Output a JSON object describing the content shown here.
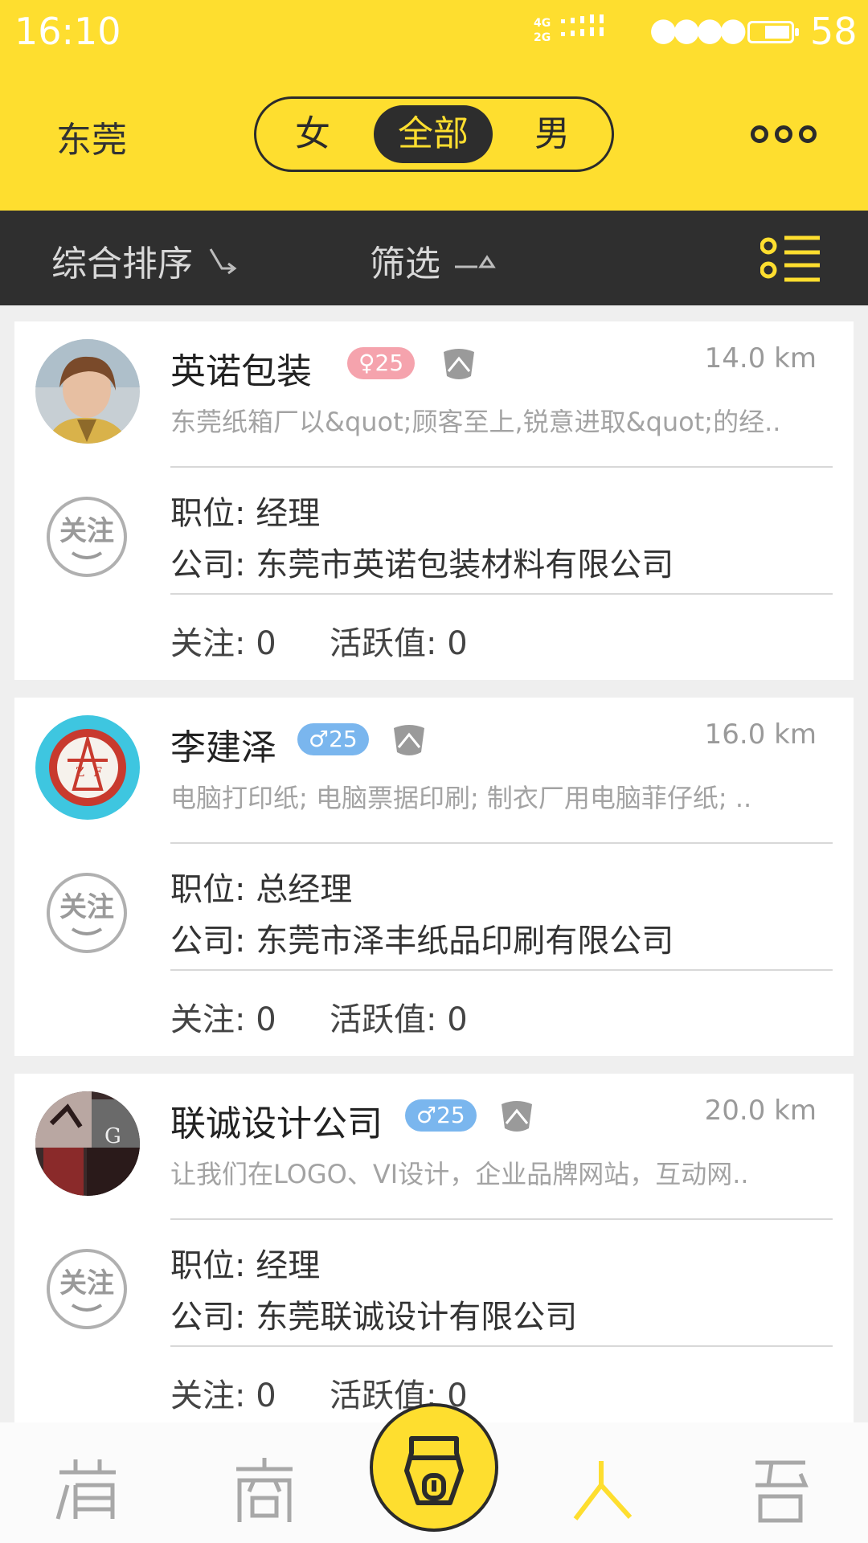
{
  "status_bar": {
    "time": "16:10",
    "network": [
      "4G",
      "2G"
    ],
    "battery_level": "58",
    "battery_fraction": 0.58
  },
  "header": {
    "city": "东莞",
    "gender_tabs": [
      {
        "label": "女",
        "selected": false
      },
      {
        "label": "全部",
        "selected": true
      },
      {
        "label": "男",
        "selected": false
      }
    ],
    "more_icon": "more-dots-icon",
    "accent_color": "#fede2f",
    "dark_color": "#2f2f2f"
  },
  "filter_bar": {
    "sort_label": "综合排序",
    "filter_label": "筛选",
    "list_view_icon": "list-view-icon"
  },
  "cards": [
    {
      "name": "英诺包装",
      "gender": "female",
      "age": "25",
      "distance": "14.0 km",
      "description": "东莞纸箱厂以&quot;顾客至上,锐意进取&quot;的经..",
      "position_label": "职位:",
      "position": "经理",
      "company_label": "公司:",
      "company": "东莞市英诺包装材料有限公司",
      "followers": "关注: 0",
      "activity": "活跃值: 0"
    },
    {
      "name": "李建泽",
      "gender": "male",
      "age": "25",
      "distance": "16.0 km",
      "description": "电脑打印纸; 电脑票据印刷; 制衣厂用电脑菲仔纸; ..",
      "position_label": "职位:",
      "position": "总经理",
      "company_label": "公司:",
      "company": "东莞市泽丰纸品印刷有限公司",
      "followers": "关注: 0",
      "activity": "活跃值: 0"
    },
    {
      "name": "联诚设计公司",
      "gender": "male",
      "age": "25",
      "distance": "20.0 km",
      "description": "让我们在LOGO、VI设计，企业品牌网站，互动网..",
      "position_label": "职位:",
      "position": "经理",
      "company_label": "公司:",
      "company": "东莞联诚设计有限公司",
      "followers": "关注: 0",
      "activity": "活跃值: 0"
    }
  ],
  "follow_button_label": "关注",
  "bottom_nav": [
    {
      "icon": "home-icon",
      "active": false
    },
    {
      "icon": "business-icon",
      "active": false
    },
    {
      "icon": "center-face-icon",
      "active": false
    },
    {
      "icon": "people-icon",
      "active": true
    },
    {
      "icon": "me-icon",
      "active": false
    }
  ]
}
